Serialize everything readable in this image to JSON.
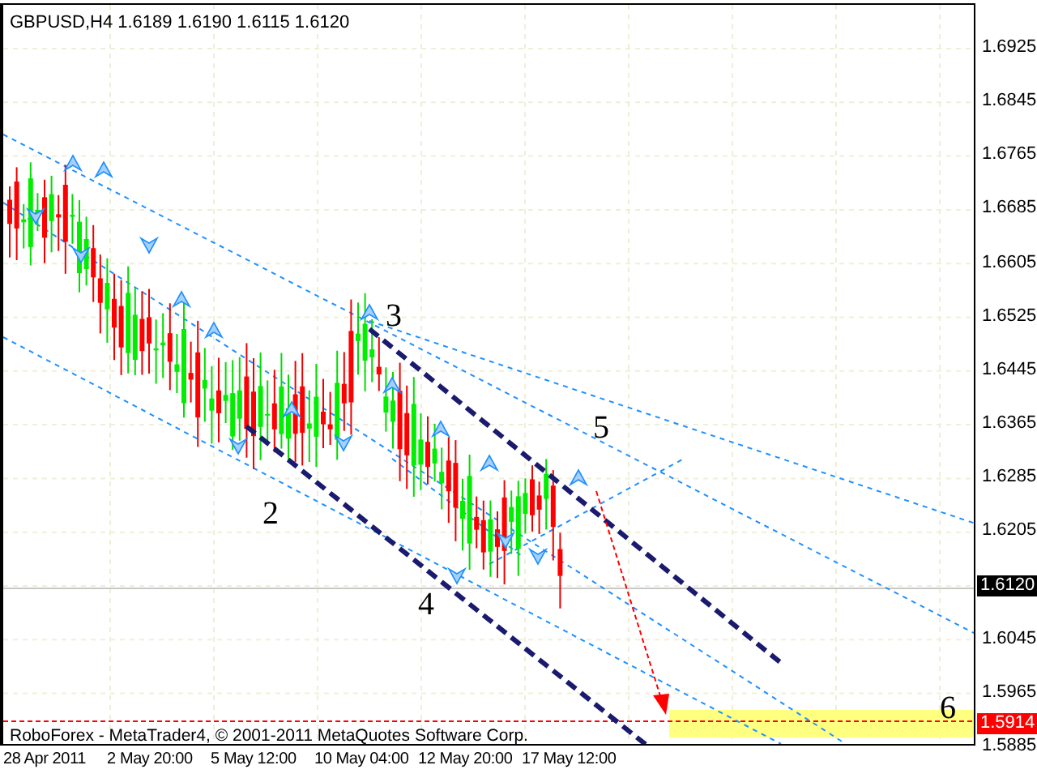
{
  "chart": {
    "symbol": "GBPUSD,H4",
    "quotes": [
      "1.6189",
      "1.6190",
      "1.6115",
      "1.6120"
    ],
    "wave_labels": [
      "2",
      "3",
      "4",
      "5",
      "6"
    ],
    "copyright": "RoboForex - MetaTrader4, © 2001-2011 MetaQuotes Software Corp.",
    "price_axis": [
      "1.6925",
      "1.6845",
      "1.6765",
      "1.6685",
      "1.6605",
      "1.6525",
      "1.6445",
      "1.6365",
      "1.6285",
      "1.6205",
      "1.6045",
      "1.5965",
      "1.5885"
    ],
    "current_price": "1.6120",
    "target_price": "1.5914",
    "time_axis": [
      "28 Apr 2011",
      "2 May 20:00",
      "5 May 12:00",
      "10 May 04:00",
      "12 May 20:00",
      "17 May 12:00"
    ]
  }
}
